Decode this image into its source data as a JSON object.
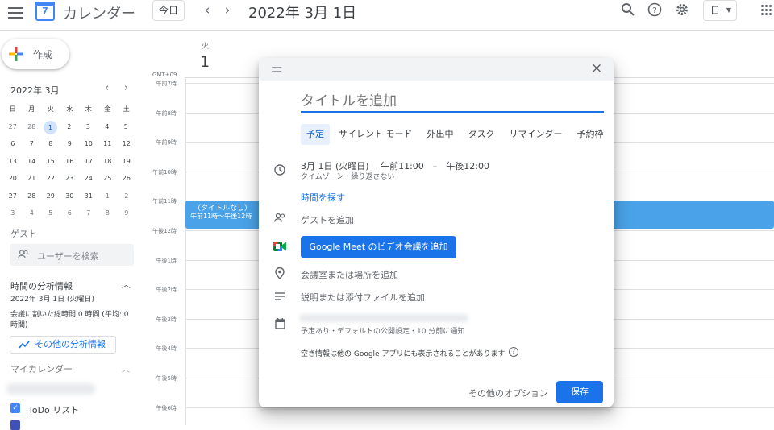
{
  "header": {
    "app_title": "カレンダー",
    "logo_day": "7",
    "today": "今日",
    "prev": "‹",
    "next": "›",
    "date": "2022年 3月 1日",
    "view": "日",
    "colors": {
      "accent": "#1a73e8",
      "event": "#4aa3e8"
    }
  },
  "sidebar": {
    "create": "作成",
    "month_title": "2022年 3月",
    "weekdays": [
      "日",
      "月",
      "火",
      "水",
      "木",
      "金",
      "土"
    ],
    "weeks": [
      [
        "27",
        "28",
        "1",
        "2",
        "3",
        "4",
        "5"
      ],
      [
        "6",
        "7",
        "8",
        "9",
        "10",
        "11",
        "12"
      ],
      [
        "13",
        "14",
        "15",
        "16",
        "17",
        "18",
        "19"
      ],
      [
        "20",
        "21",
        "22",
        "23",
        "24",
        "25",
        "26"
      ],
      [
        "27",
        "28",
        "29",
        "30",
        "31",
        "1",
        "2"
      ],
      [
        "3",
        "4",
        "5",
        "6",
        "7",
        "8",
        "9"
      ]
    ],
    "selected_day": "1",
    "guest_section": "ゲスト",
    "search_users": "ユーザーを検索",
    "analysis_title": "時間の分析情報",
    "analysis_date": "2022年 3月 1日 (火曜日)",
    "analysis_line1": "会議に割いた総時間 0 時間 (平均: 0",
    "analysis_line2": "時間)",
    "more_analysis": "その他の分析情報",
    "my_calendars": "マイカレンダー",
    "todo": "ToDo リスト"
  },
  "day": {
    "weekday": "火",
    "day_num": "1",
    "timezone": "GMT+09",
    "times": [
      "午前7時",
      "午前8時",
      "午前9時",
      "午前10時",
      "午前11時",
      "午後12時",
      "午後1時",
      "午後2時",
      "午後3時",
      "午後4時",
      "午後5時",
      "午後6時"
    ],
    "event_title": "（タイトルなし）",
    "event_time": "午前11時～午後12時"
  },
  "modal": {
    "close": "×",
    "title_placeholder": "タイトルを追加",
    "tabs": [
      "予定",
      "サイレント モード",
      "外出中",
      "タスク",
      "リマインダー",
      "予約枠"
    ],
    "datetime": "3月 1日 (火曜日)　 午前11:00　–　午後12:00",
    "datetime_sub": "タイムゾーン・繰り返さない",
    "find_time": "時間を探す",
    "guests": "ゲストを追加",
    "meet": "Google Meet のビデオ会議を追加",
    "location": "会議室または場所を追加",
    "description": "説明または添付ファイルを追加",
    "calendar_sub": "予定あり・デフォルトの公開設定・10 分前に通知",
    "availability": "空き情報は他の Google アプリにも表示されることがあります",
    "more_options": "その他のオプション",
    "save": "保存"
  }
}
